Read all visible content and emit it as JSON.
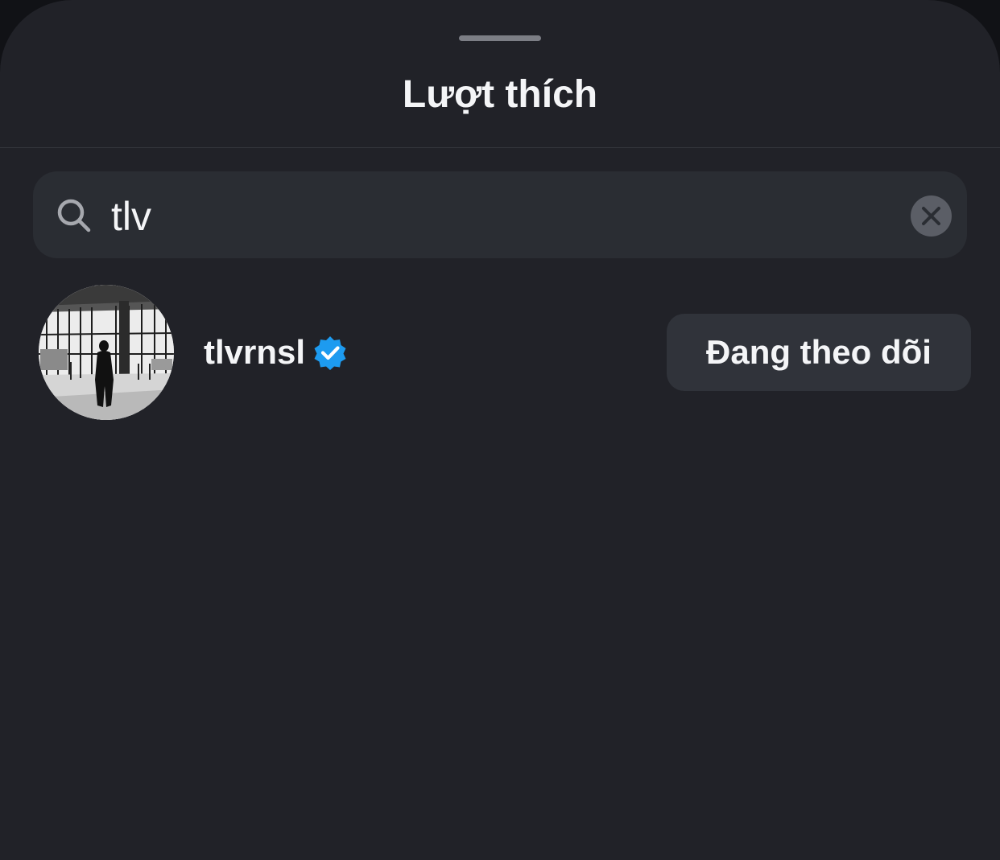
{
  "sheet": {
    "title": "Lượt thích"
  },
  "search": {
    "value": "tlv",
    "icon": "search-icon",
    "clear_icon": "close-icon"
  },
  "results": [
    {
      "username": "tlvrnsl",
      "verified": true,
      "follow_label": "Đang theo dõi"
    }
  ],
  "colors": {
    "background": "#212228",
    "search_field": "#2a2d33",
    "button": "#30333a",
    "verified_badge": "#1d9bf0",
    "text": "#f4f5f7"
  }
}
